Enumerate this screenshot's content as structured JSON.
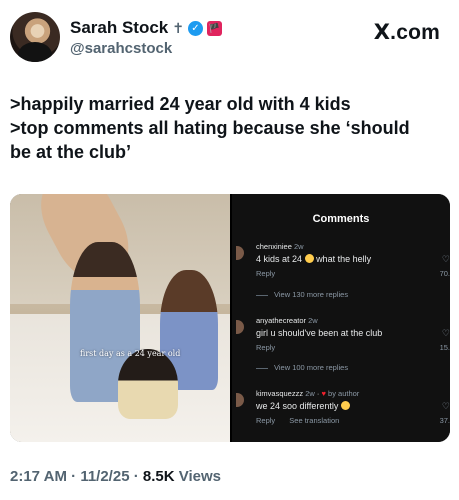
{
  "author": {
    "name": "Sarah Stock",
    "handle": "@sarahcstock",
    "cross_glyph": "✝",
    "verified_glyph": "✓",
    "badge_glyph": "🏴"
  },
  "brand": {
    "x": "X",
    "rest": ".com"
  },
  "tweet": {
    "lines": [
      ">happily married 24 year old with 4 kids",
      ">top comments all hating because she ‘should be at the club’"
    ]
  },
  "media": {
    "photo_caption": "first day as a 24 year old",
    "comments_panel": {
      "title": "Comments",
      "comments": [
        {
          "user": "chenxiniee",
          "time": "2w",
          "text": "4 kids at 24",
          "text_after": "what the helly",
          "reply": "Reply",
          "count": "70.",
          "view_more": "View 130 more replies"
        },
        {
          "user": "anyathecreator",
          "time": "2w",
          "text": "girl u should've been at the club",
          "text_after": "",
          "reply": "Reply",
          "count": "15.",
          "view_more": "View 100 more replies"
        },
        {
          "user": "kimvasquezzz",
          "time": "2w",
          "by_author": "by author",
          "text": "we 24 soo differently",
          "text_after": "",
          "reply": "Reply",
          "see_translation": "See translation",
          "count": "37."
        }
      ]
    }
  },
  "footer": {
    "time": "2:17 AM",
    "sep": " · ",
    "date": "11/2/25",
    "views_count": "8.5K",
    "views_label": " Views"
  },
  "icons": [
    "avatar",
    "verified-icon",
    "heart-icon",
    "like-icon",
    "emoji-icon"
  ],
  "colors": {
    "accent": "#1d9bf0",
    "muted": "#536471",
    "panel_bg": "#111111",
    "heart": "#f4212e"
  }
}
